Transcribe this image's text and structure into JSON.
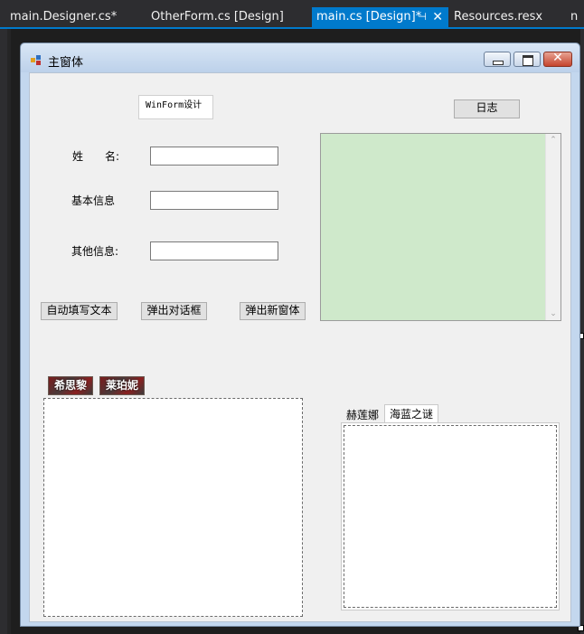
{
  "editor_tabs": [
    {
      "label": "main.Designer.cs*",
      "active": false
    },
    {
      "label": "OtherForm.cs [Design]",
      "active": false
    },
    {
      "label": "main.cs [Design]*",
      "active": true
    },
    {
      "label": "Resources.resx",
      "active": false
    },
    {
      "label": "n",
      "active": false
    }
  ],
  "form": {
    "title": "主窗体",
    "groupbox_label": "WinForm设计",
    "log_button": "日志",
    "name_label": "姓　　名:",
    "name_value": "",
    "basic_info_label": "基本信息",
    "basic_info_value": "",
    "other_info_label": "其他信息:",
    "other_info_value": "",
    "autofill_button": "自动填写文本",
    "dialog_button": "弹出对话框",
    "new_window_button": "弹出新窗体",
    "image_tabs": [
      "希思黎",
      "莱珀妮"
    ],
    "tab_control": {
      "tabs": [
        "赫莲娜",
        "海蓝之谜"
      ],
      "selected": "海蓝之谜"
    }
  },
  "colors": {
    "accent": "#007acc",
    "listbox_bg": "#cfe9cb",
    "form_bg": "#f0f0f0"
  }
}
